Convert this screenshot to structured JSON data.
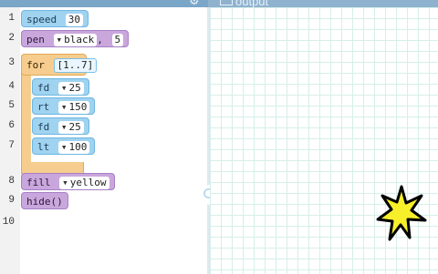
{
  "header": {
    "output_label": "output",
    "settings_icon": "gear-icon",
    "output_icon": "window-icon"
  },
  "editor": {
    "line_numbers": [
      "1",
      "2",
      "3",
      "4",
      "5",
      "6",
      "7",
      "8",
      "9",
      "10"
    ],
    "blocks": {
      "speed": {
        "keyword": "speed",
        "value": "30"
      },
      "pen": {
        "keyword": "pen",
        "color": "black",
        "width": "5"
      },
      "for": {
        "keyword": "for",
        "range": "[1..7]"
      },
      "fd1": {
        "keyword": "fd",
        "value": "25"
      },
      "rt": {
        "keyword": "rt",
        "value": "150"
      },
      "fd2": {
        "keyword": "fd",
        "value": "25"
      },
      "lt": {
        "keyword": "lt",
        "value": "100"
      },
      "fill": {
        "keyword": "fill",
        "color": "yellow"
      },
      "hide": {
        "keyword": "hide()"
      }
    }
  },
  "controls": {
    "run_icon": "refresh-icon"
  },
  "colors": {
    "block_blue": "#9fd3f0",
    "block_purple": "#c9a7dd",
    "block_orange": "#f6cd8e",
    "star_fill": "#f7ef2a",
    "grid_line": "#d6efe9"
  }
}
